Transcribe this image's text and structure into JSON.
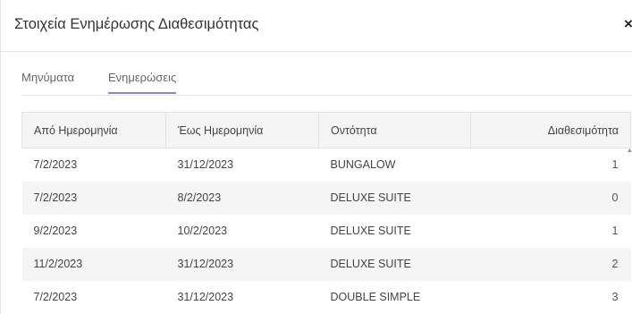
{
  "modal": {
    "title": "Στοιχεία Ενημέρωσης Διαθεσιμότητας",
    "close_label": "×"
  },
  "tabs": [
    {
      "label": "Μηνύματα",
      "active": false
    },
    {
      "label": "Ενημερώσεις",
      "active": true
    }
  ],
  "table": {
    "columns": [
      "Από Ημερομηνία",
      "Έως Ημερομηνία",
      "Οντότητα",
      "Διαθεσιμότητα"
    ],
    "rows": [
      [
        "7/2/2023",
        "31/12/2023",
        "BUNGALOW",
        "1"
      ],
      [
        "7/2/2023",
        "8/2/2023",
        "DELUXE SUITE",
        "0"
      ],
      [
        "9/2/2023",
        "10/2/2023",
        "DELUXE SUITE",
        "1"
      ],
      [
        "11/2/2023",
        "31/12/2023",
        "DELUXE SUITE",
        "2"
      ],
      [
        "7/2/2023",
        "31/12/2023",
        "DOUBLE SIMPLE",
        "3"
      ]
    ]
  },
  "colors": {
    "active_tab_underline": "#8a89b7",
    "header_bg": "#f5f5f5",
    "stripe_bg": "#f5f5f5"
  },
  "icons": {
    "close": "close-icon",
    "scroll_up": "scroll-up-arrow-icon"
  }
}
